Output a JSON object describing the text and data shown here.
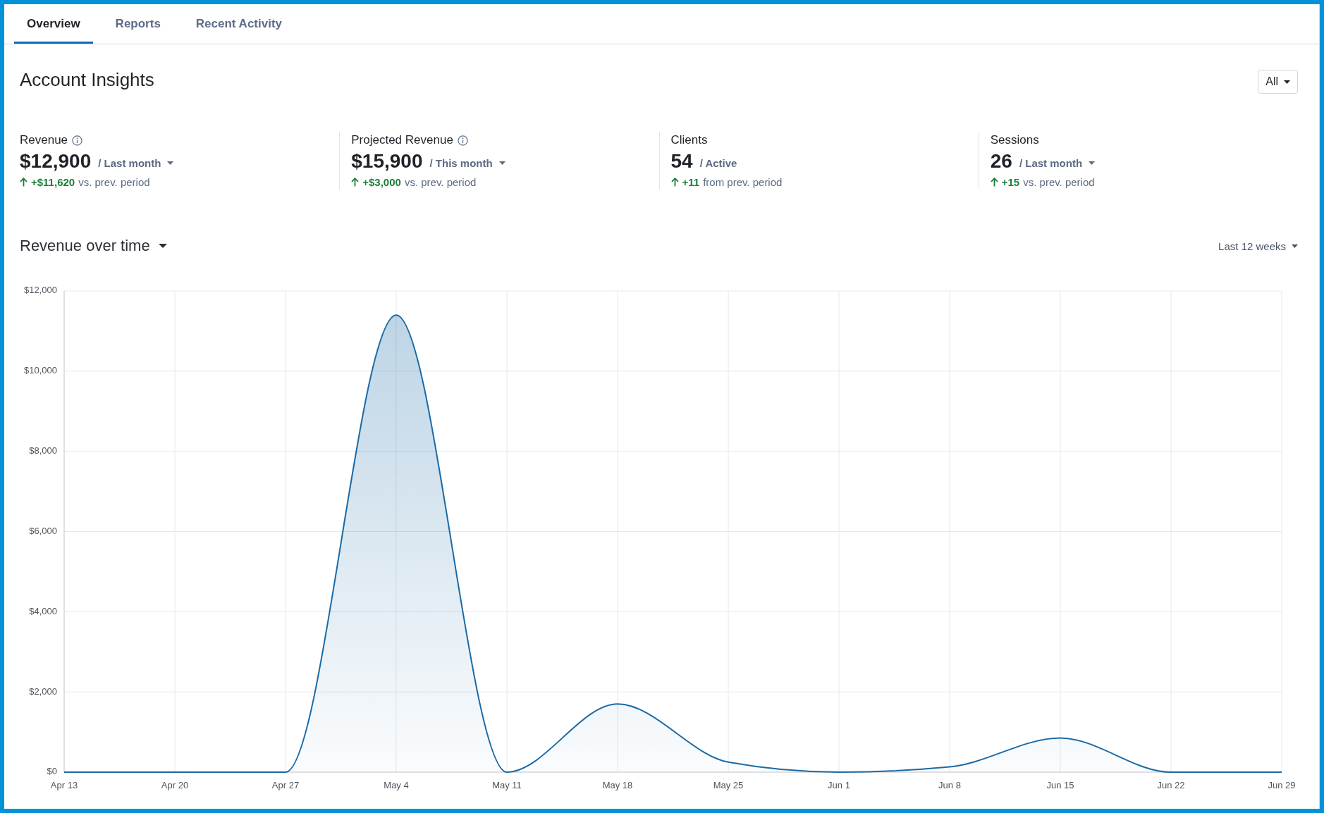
{
  "tabs": [
    {
      "label": "Overview",
      "selected": true
    },
    {
      "label": "Reports",
      "selected": false
    },
    {
      "label": "Recent Activity",
      "selected": false
    }
  ],
  "header": {
    "title": "Account Insights",
    "filter": "All"
  },
  "metrics": [
    {
      "label": "Revenue",
      "info_icon": true,
      "value": "$12,900",
      "period": "/ Last month",
      "period_dropdown": true,
      "positive": true,
      "change": "+$11,620",
      "change_text": "vs. prev. period"
    },
    {
      "label": "Projected Revenue",
      "info_icon": true,
      "value": "$15,900",
      "period": "/ This month",
      "period_dropdown": true,
      "positive": true,
      "change": "+$3,000",
      "change_text": "vs. prev. period"
    },
    {
      "label": "Clients",
      "info_icon": false,
      "value": "54",
      "period": "/ Active",
      "period_dropdown": false,
      "positive": true,
      "change": "+11",
      "change_text": "from prev. period"
    },
    {
      "label": "Sessions",
      "info_icon": false,
      "value": "26",
      "period": "/ Last month",
      "period_dropdown": true,
      "positive": true,
      "change": "+15",
      "change_text": "vs. prev. period"
    }
  ],
  "revenue_chart": {
    "title": "Revenue over time",
    "range": "Last 12 weeks",
    "chart_data": {
      "type": "area",
      "categories": [
        "Apr 13",
        "Apr 20",
        "Apr 27",
        "May 4",
        "May 11",
        "May 18",
        "May 25",
        "Jun 1",
        "Jun 8",
        "Jun 15",
        "Jun 22",
        "Jun 29"
      ],
      "values": [
        0,
        0,
        0,
        11400,
        0,
        1700,
        250,
        0,
        130,
        850,
        0,
        0
      ],
      "ylim": [
        0,
        12000
      ],
      "yticks": [
        {
          "value": 0,
          "label": "$0"
        },
        {
          "value": 2000,
          "label": "$2,000"
        },
        {
          "value": 4000,
          "label": "$4,000"
        },
        {
          "value": 6000,
          "label": "$6,000"
        },
        {
          "value": 8000,
          "label": "$8,000"
        },
        {
          "value": 10000,
          "label": "$10,000"
        },
        {
          "value": 12000,
          "label": "$12,000"
        }
      ],
      "grid": true
    }
  }
}
